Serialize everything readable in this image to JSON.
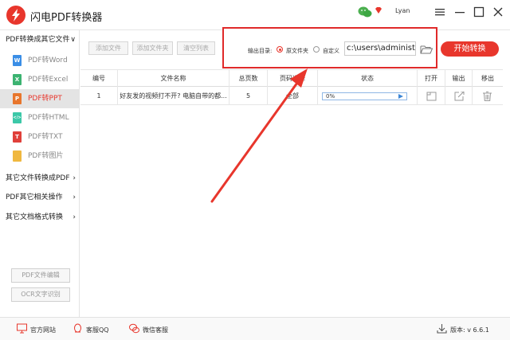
{
  "app": {
    "title": "闪电PDF转换器",
    "user": "Lyan"
  },
  "sidebar": {
    "groups": [
      {
        "label": "PDF转换成其它文件",
        "chevron": "∨"
      },
      {
        "label": "其它文件转换成PDF",
        "chevron": "›"
      },
      {
        "label": "PDF其它相关操作",
        "chevron": "›"
      },
      {
        "label": "其它文档格式转换",
        "chevron": "›"
      }
    ],
    "items": [
      {
        "label": "PDF转Word",
        "letter": "W",
        "color": "#3a8ee6"
      },
      {
        "label": "PDF转Excel",
        "letter": "X",
        "color": "#3cb371"
      },
      {
        "label": "PDF转PPT",
        "letter": "P",
        "color": "#e8762c"
      },
      {
        "label": "PDF转HTML",
        "letter": "</>",
        "color": "#3cc8a8"
      },
      {
        "label": "PDF转TXT",
        "letter": "T",
        "color": "#e0403a"
      },
      {
        "label": "PDF转图片",
        "letter": "",
        "color": "#f0b840"
      }
    ],
    "buttons": [
      "PDF文件编辑",
      "OCR文字识别"
    ]
  },
  "toolbar": {
    "add_file": "添加文件",
    "add_folder": "添加文件夹",
    "clear_list": "清空列表",
    "start": "开始转换"
  },
  "output": {
    "label": "输出目录:",
    "option_source": "原文件夹",
    "option_custom": "自定义",
    "path": "c:\\users\\administ"
  },
  "table": {
    "headers": [
      "编号",
      "文件名称",
      "总页数",
      "页码选择",
      "状态",
      "打开",
      "输出",
      "移出"
    ],
    "rows": [
      {
        "index": "1",
        "name": "好友发的视频打不开? 电脑自带的都...",
        "pages": "5",
        "range": "全部",
        "progress": "0%"
      }
    ]
  },
  "footer": {
    "website": "官方网站",
    "qq": "客服QQ",
    "wechat": "微信客服",
    "version_label": "版本:",
    "version": "v 6.6.1"
  },
  "colors": {
    "accent": "#e8362c",
    "highlight_border": "#e02a2a"
  }
}
